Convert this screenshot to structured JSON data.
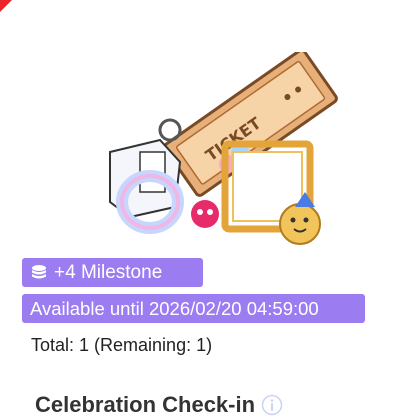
{
  "reward": {
    "image_icon": "ticket-frame-reward-icon",
    "milestone_label": "+4 Milestone",
    "milestone_icon": "coin-stack-icon",
    "availability_label": "Available until 2026/02/20 04:59:00",
    "total_label": "Total: 1 (Remaining: 1)"
  },
  "section": {
    "title": "Celebration Check-in",
    "info_icon": "info-circle-icon"
  },
  "colors": {
    "badge_bg": "#9b7cf1",
    "corner_flag": "#e8262c",
    "info_icon": "#c9d3f3"
  }
}
